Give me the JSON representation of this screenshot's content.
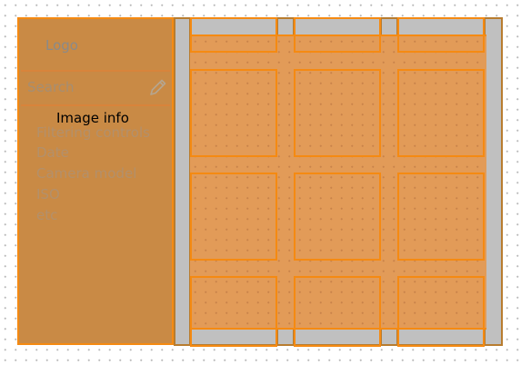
{
  "sidebar": {
    "logo": "Logo",
    "search_label": "Search",
    "search_icon": "pencil-icon",
    "image_info": "Image info",
    "filters": [
      {
        "label": "Filtering controls"
      },
      {
        "label": "Date"
      },
      {
        "label": "Camera model"
      },
      {
        "label": "ISO"
      },
      {
        "label": "etc"
      }
    ]
  },
  "colors": {
    "sidebar_fill": "#c98a45",
    "accent": "#f58a12",
    "grid_frame": "#c0c0c0",
    "tile_fill": "#e29b58"
  },
  "grid": {
    "columns": 3,
    "rows": 4,
    "tiles": [
      {
        "row": 1,
        "col": 1
      },
      {
        "row": 1,
        "col": 2
      },
      {
        "row": 1,
        "col": 3
      },
      {
        "row": 2,
        "col": 1
      },
      {
        "row": 2,
        "col": 2
      },
      {
        "row": 2,
        "col": 3
      },
      {
        "row": 3,
        "col": 1
      },
      {
        "row": 3,
        "col": 2
      },
      {
        "row": 3,
        "col": 3
      },
      {
        "row": 4,
        "col": 1
      },
      {
        "row": 4,
        "col": 2
      },
      {
        "row": 4,
        "col": 3
      }
    ]
  }
}
